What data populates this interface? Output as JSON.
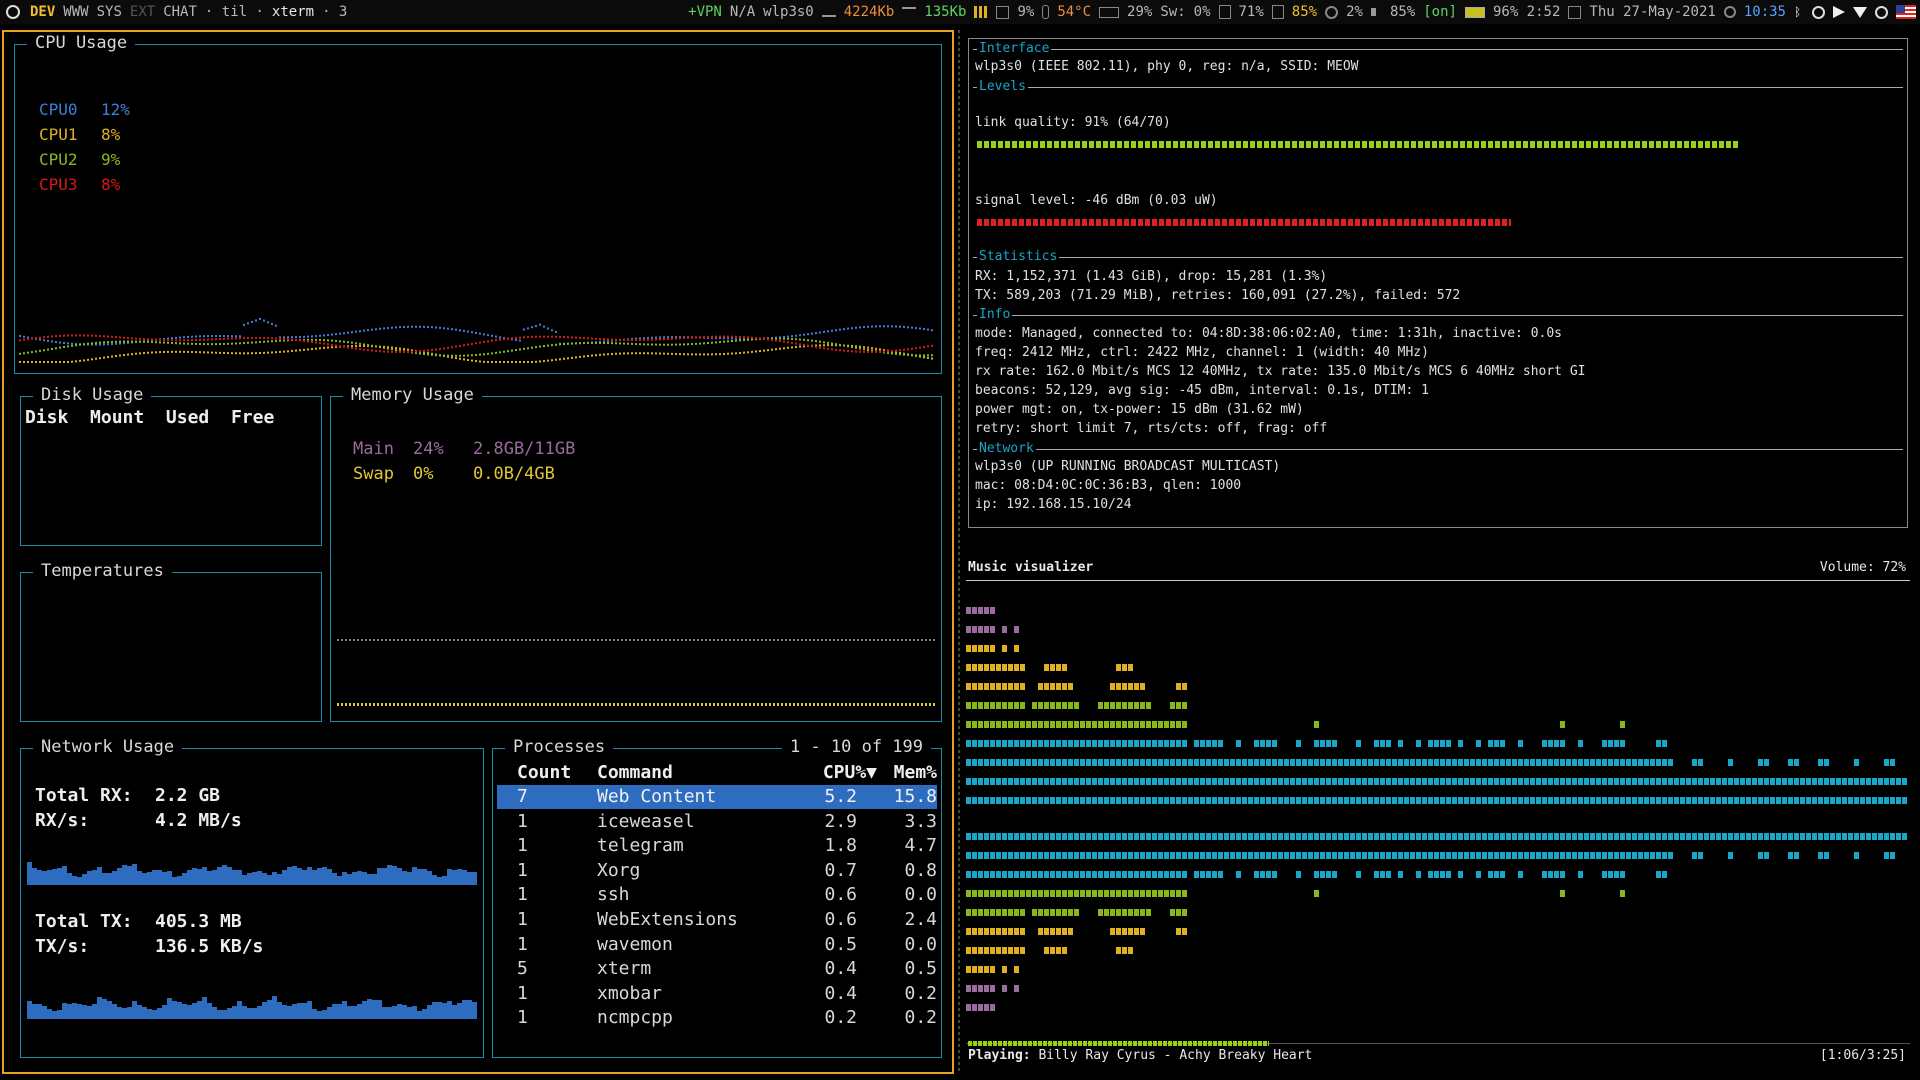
{
  "topbar": {
    "workspaces": [
      {
        "label": "DEV",
        "state": "active"
      },
      {
        "label": "WWW",
        "state": "normal"
      },
      {
        "label": "SYS",
        "state": "normal"
      },
      {
        "label": "EXT",
        "state": "dim"
      },
      {
        "label": "CHAT",
        "state": "normal"
      }
    ],
    "layout": "· til ·",
    "window_title": "xterm",
    "window_count": "· 3",
    "vpn": "+VPN",
    "vpn_status": "N/A",
    "iface": "wlp3s0",
    "rx": "4224Kb",
    "tx": "135Kb",
    "cpu": "9%",
    "temp": "54°C",
    "mem": "29%",
    "swap_label": "Sw:",
    "swap": "0%",
    "disk": "71%",
    "disk2": "85%",
    "load": "2%",
    "volume": "85%",
    "volume_state": "[on]",
    "battery": "96% 2:52",
    "date": "Thu 27-May-2021",
    "time": "10:35"
  },
  "gotop": {
    "cpu": {
      "title": "CPU Usage",
      "cores": [
        {
          "name": "CPU0",
          "value": "12%",
          "color": "#3d7fd6"
        },
        {
          "name": "CPU1",
          "value": "8%",
          "color": "#e0b020"
        },
        {
          "name": "CPU2",
          "value": "9%",
          "color": "#8ab81a"
        },
        {
          "name": "CPU3",
          "value": "8%",
          "color": "#d81818"
        }
      ]
    },
    "disk": {
      "title": "Disk Usage",
      "headers": [
        "Disk",
        "Mount",
        "Used",
        "Free"
      ]
    },
    "temps": {
      "title": "Temperatures"
    },
    "memory": {
      "title": "Memory Usage",
      "main": {
        "label": "Main",
        "pct": "24%",
        "value": "2.8GB/11GB",
        "color": "#9a6aa0"
      },
      "swap": {
        "label": "Swap",
        "pct": "0%",
        "value": "0.0B/4GB",
        "color": "#e0c830"
      }
    },
    "network": {
      "title": "Network Usage",
      "total_rx_label": "Total RX:",
      "total_rx": "2.2 GB",
      "rx_rate_label": "RX/s:",
      "rx_rate": "4.2 MB/s",
      "total_tx_label": "Total TX:",
      "total_tx": "405.3 MB",
      "tx_rate_label": "TX/s:",
      "tx_rate": "136.5 KB/s"
    },
    "processes": {
      "title": "Processes",
      "range": "1 - 10 of 199",
      "headers": {
        "count": "Count",
        "command": "Command",
        "cpu": "CPU%▼",
        "mem": "Mem%"
      },
      "rows": [
        {
          "count": "7",
          "command": "Web Content",
          "cpu": "5.2",
          "mem": "15.8",
          "selected": true
        },
        {
          "count": "1",
          "command": "iceweasel",
          "cpu": "2.9",
          "mem": "3.3"
        },
        {
          "count": "1",
          "command": "telegram",
          "cpu": "1.8",
          "mem": "4.7"
        },
        {
          "count": "1",
          "command": "Xorg",
          "cpu": "0.7",
          "mem": "0.8"
        },
        {
          "count": "1",
          "command": "ssh",
          "cpu": "0.6",
          "mem": "0.0"
        },
        {
          "count": "1",
          "command": "WebExtensions",
          "cpu": "0.6",
          "mem": "2.4"
        },
        {
          "count": "1",
          "command": "wavemon",
          "cpu": "0.5",
          "mem": "0.0"
        },
        {
          "count": "5",
          "command": "xterm",
          "cpu": "0.4",
          "mem": "0.5"
        },
        {
          "count": "1",
          "command": "xmobar",
          "cpu": "0.4",
          "mem": "0.2"
        },
        {
          "count": "1",
          "command": "ncmpcpp",
          "cpu": "0.2",
          "mem": "0.2"
        }
      ]
    }
  },
  "wavemon": {
    "sections": {
      "interface": "Interface",
      "levels": "Levels",
      "statistics": "Statistics",
      "info": "Info",
      "network": "Network"
    },
    "iface_line": "wlp3s0 (IEEE 802.11), phy 0, reg: n/a, SSID: MEOW",
    "link_quality": "link quality: 91%  (64/70)",
    "link_quality_fraction": 0.91,
    "signal_level": "signal level: -46 dBm (0.03 uW)",
    "signal_fraction": 0.58,
    "rx": "RX: 1,152,371 (1.43 GiB), drop: 15,281 (1.3%)",
    "tx": "TX: 589,203 (71.29 MiB), retries: 160,091 (27.2%), failed: 572",
    "info": [
      "mode: Managed, connected to: 04:8D:38:06:02:A0, time: 1:31h, inactive: 0.0s",
      "freq: 2412 MHz, ctrl: 2422 MHz, channel: 1 (width: 40 MHz)",
      "rx rate: 162.0 Mbit/s MCS 12 40MHz, tx rate: 135.0 Mbit/s MCS 6 40MHz short GI",
      "beacons: 52,129, avg sig: -45 dBm, interval: 0.1s, DTIM: 1",
      "power mgt: on,  tx-power: 15 dBm (31.62 mW)",
      "retry: short limit 7,  rts/cts: off,  frag: off"
    ],
    "net": [
      "wlp3s0 (UP RUNNING BROADCAST MULTICAST)",
      "mac: 08:D4:0C:0C:36:B3, qlen: 1000",
      "ip: 192.168.15.10/24"
    ]
  },
  "visualizer": {
    "title": "Music visualizer",
    "volume": "Volume: 72%",
    "playing_label": "Playing:",
    "track": "Billy Ray Cyrus - Achy Breaky Heart",
    "time": "[1:06/3:25]",
    "progress": 0.32
  }
}
